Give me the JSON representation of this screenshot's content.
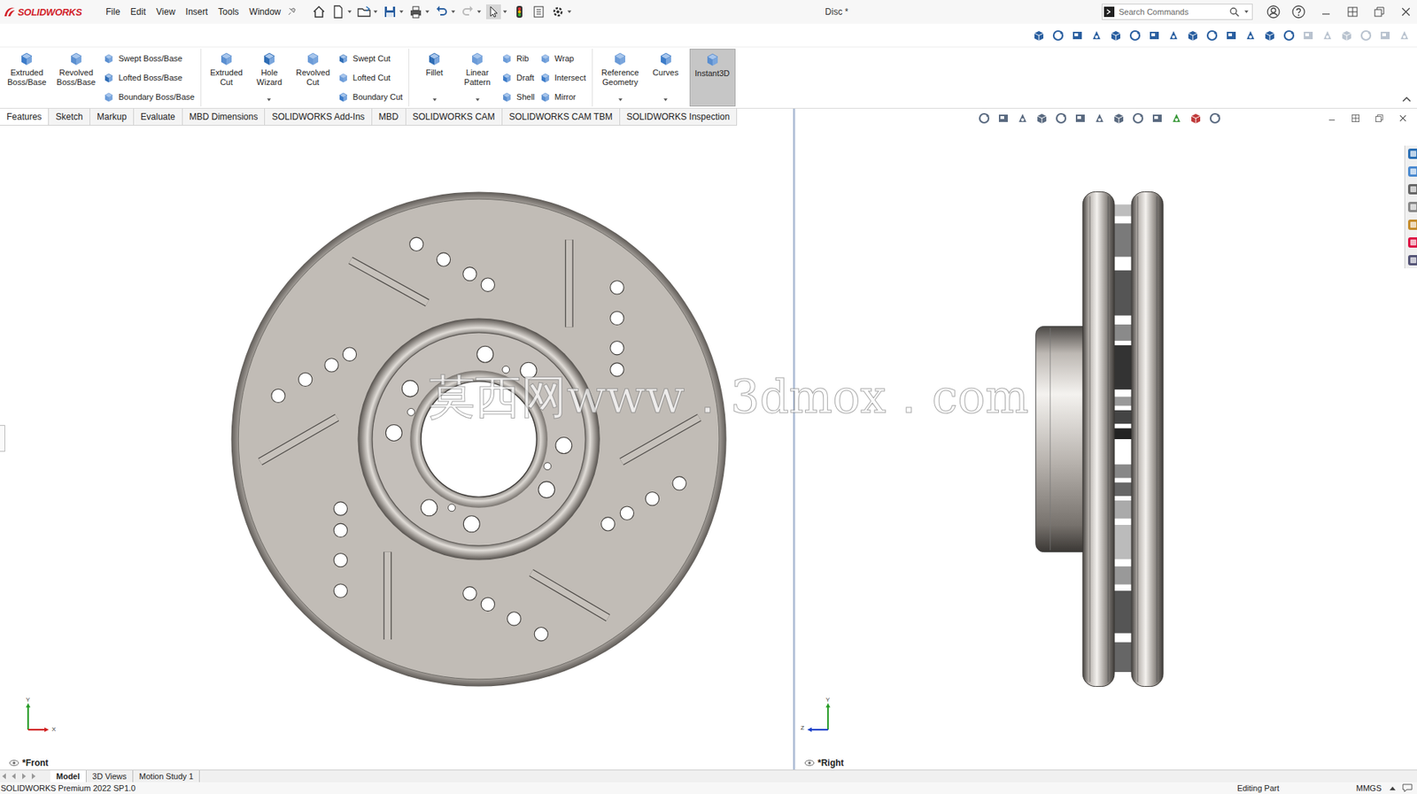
{
  "app": {
    "logo": "SOLIDWORKS",
    "title": "Disc *"
  },
  "menu": [
    "File",
    "Edit",
    "View",
    "Insert",
    "Tools",
    "Window"
  ],
  "search": {
    "placeholder": "Search Commands"
  },
  "ribbon": [
    {
      "items": [
        {
          "kind": "large",
          "lines": [
            "Extruded",
            "Boss/Base"
          ],
          "dropdown": false,
          "selected": false
        },
        {
          "kind": "large",
          "lines": [
            "Revolved",
            "Boss/Base"
          ],
          "dropdown": false,
          "selected": false
        },
        {
          "kind": "stack",
          "entries": [
            "Swept Boss/Base",
            "Lofted Boss/Base",
            "Boundary Boss/Base"
          ]
        }
      ]
    },
    {
      "items": [
        {
          "kind": "large",
          "lines": [
            "Extruded",
            "Cut"
          ],
          "dropdown": false,
          "selected": false
        },
        {
          "kind": "large",
          "lines": [
            "Hole",
            "Wizard"
          ],
          "dropdown": true,
          "selected": false
        },
        {
          "kind": "large",
          "lines": [
            "Revolved",
            "Cut"
          ],
          "dropdown": false,
          "selected": false
        },
        {
          "kind": "stack",
          "entries": [
            "Swept Cut",
            "Lofted Cut",
            "Boundary Cut"
          ]
        }
      ]
    },
    {
      "items": [
        {
          "kind": "large",
          "lines": [
            "Fillet"
          ],
          "dropdown": true,
          "selected": false
        },
        {
          "kind": "large",
          "lines": [
            "Linear",
            "Pattern"
          ],
          "dropdown": true,
          "selected": false
        },
        {
          "kind": "stack",
          "entries": [
            "Rib",
            "Draft",
            "Shell"
          ]
        },
        {
          "kind": "stack",
          "entries": [
            "Wrap",
            "Intersect",
            "Mirror"
          ]
        }
      ]
    },
    {
      "items": [
        {
          "kind": "large",
          "lines": [
            "Reference",
            "Geometry"
          ],
          "dropdown": true,
          "selected": false
        },
        {
          "kind": "large",
          "lines": [
            "Curves"
          ],
          "dropdown": true,
          "selected": false
        },
        {
          "kind": "large",
          "lines": [
            "Instant3D"
          ],
          "dropdown": false,
          "selected": true
        }
      ]
    }
  ],
  "command_tabs": [
    {
      "label": "Features",
      "selected": true
    },
    {
      "label": "Sketch",
      "selected": false
    },
    {
      "label": "Markup",
      "selected": false
    },
    {
      "label": "Evaluate",
      "selected": false
    },
    {
      "label": "MBD Dimensions",
      "selected": false
    },
    {
      "label": "SOLIDWORKS Add-Ins",
      "selected": false
    },
    {
      "label": "MBD",
      "selected": false
    },
    {
      "label": "SOLIDWORKS CAM",
      "selected": false
    },
    {
      "label": "SOLIDWORKS CAM TBM",
      "selected": false
    },
    {
      "label": "SOLIDWORKS Inspection",
      "selected": false
    }
  ],
  "viewports": [
    {
      "label": "*Front",
      "axes": [
        "Y",
        "X"
      ]
    },
    {
      "label": "*Right",
      "axes": [
        "Y",
        "Z"
      ]
    }
  ],
  "watermark": "莫西网www．3dmox．com",
  "bottom_tabs": [
    {
      "label": "Model",
      "selected": true
    },
    {
      "label": "3D Views",
      "selected": false
    },
    {
      "label": "Motion Study 1",
      "selected": false
    }
  ],
  "status_bar": {
    "product": "SOLIDWORKS Premium 2022 SP1.0",
    "mode": "Editing Part",
    "units": "MMGS"
  }
}
